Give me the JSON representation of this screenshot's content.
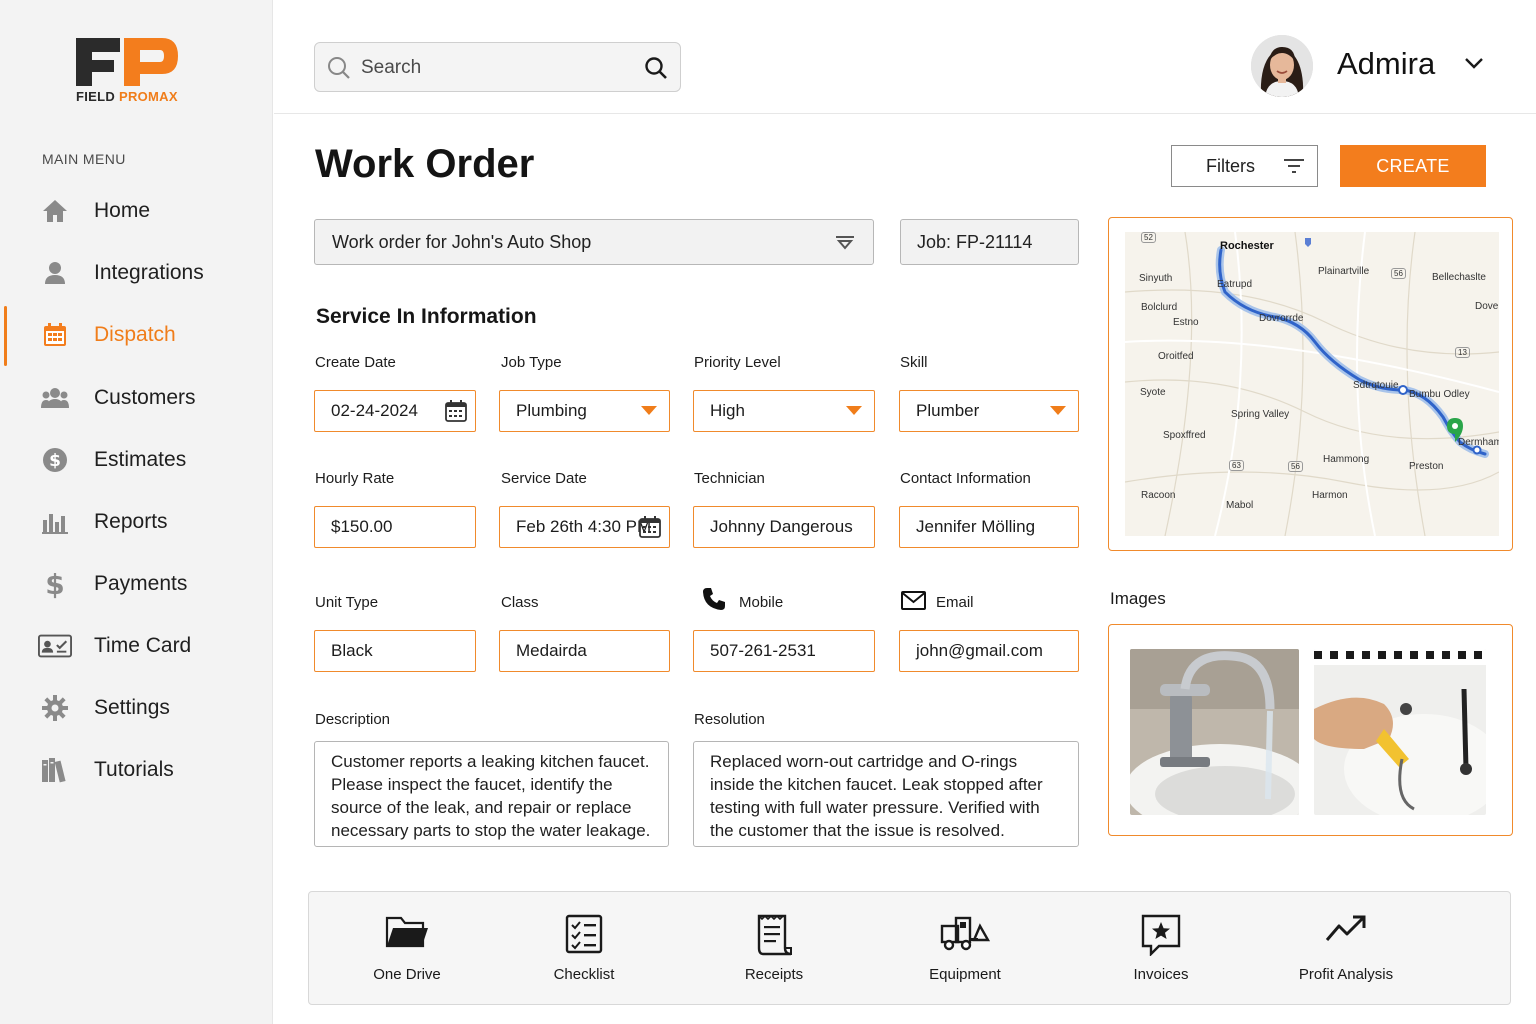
{
  "brand": {
    "logo_mark": "FP",
    "name_part1": "FIELD ",
    "name_part2": "PROMAX",
    "accent_color": "#f37d1d"
  },
  "sidebar": {
    "menu_title": "MAIN MENU",
    "items": [
      {
        "label": "Home",
        "icon": "home-icon",
        "active": false
      },
      {
        "label": "Integrations",
        "icon": "user-icon",
        "active": false
      },
      {
        "label": "Dispatch",
        "icon": "calendar-icon",
        "active": true
      },
      {
        "label": "Customers",
        "icon": "users-icon",
        "active": false
      },
      {
        "label": "Estimates",
        "icon": "dollar-circle-icon",
        "active": false
      },
      {
        "label": "Reports",
        "icon": "bar-chart-icon",
        "active": false
      },
      {
        "label": "Payments",
        "icon": "dollar-icon",
        "active": false
      },
      {
        "label": "Time Card",
        "icon": "id-card-icon",
        "active": false
      },
      {
        "label": "Settings",
        "icon": "gear-icon",
        "active": false
      },
      {
        "label": "Tutorials",
        "icon": "books-icon",
        "active": false
      }
    ]
  },
  "topbar": {
    "search_placeholder": "Search",
    "user_name": "Admira"
  },
  "header": {
    "title": "Work Order",
    "filters_label": "Filters",
    "create_label": "CREATE"
  },
  "work_order": {
    "selected": "Work order for John's Auto Shop",
    "job": "Job: FP-21114"
  },
  "service": {
    "section_title": "Service In Information",
    "create_date_label": "Create Date",
    "create_date": "02-24-2024",
    "job_type_label": "Job Type",
    "job_type": "Plumbing",
    "priority_label": "Priority Level",
    "priority": "High",
    "skill_label": "Skill",
    "skill": "Plumber",
    "hourly_rate_label": "Hourly Rate",
    "hourly_rate": "$150.00",
    "service_date_label": "Service Date",
    "service_date": "Feb 26th 4:30 PM",
    "technician_label": "Technician",
    "technician": "Johnny Dangerous",
    "contact_label": "Contact Information",
    "contact": "Jennifer Mölling",
    "unit_type_label": "Unit Type",
    "unit_type": "Black",
    "class_label": "Class",
    "class": "Medairda",
    "mobile_label": "Mobile",
    "mobile": "507-261-2531",
    "email_label": "Email",
    "email": "john@gmail.com",
    "description_label": "Description",
    "description": "Customer reports a leaking kitchen faucet. Please inspect the faucet, identify the source of the leak, and repair or replace necessary parts to stop the water leakage.",
    "resolution_label": "Resolution",
    "resolution": "Replaced worn-out cartridge and O-rings inside the kitchen faucet. Leak stopped after testing with full water pressure. Verified with the customer that the issue is resolved."
  },
  "map": {
    "labels": {
      "rochester": "Rochester",
      "plainartville": "Plainartville",
      "bellechaslte": "Bellechaslte",
      "dover": "Dover",
      "sinyuth": "Sinyuth",
      "bolclurd": "Bolclurd",
      "eatrupd": "Eatrupd",
      "estno": "Estno",
      "dovrorrde": "Dovrorrde",
      "oroitfed": "Oroitfed",
      "syote": "Syote",
      "sdtrqtouie": "Sdtrqtouie",
      "bumbu_odley": "Bumbu Odley",
      "spring_valley": "Spring Valley",
      "spoxffred": "Spoxffred",
      "hammong": "Hammong",
      "preston": "Preston",
      "racoon": "Racoon",
      "mabol": "Mabol",
      "harmon": "Harmon",
      "dermham": "Dermham",
      "shield_52": "52",
      "shield_56": "56",
      "shield_63": "63",
      "shield_13": "13"
    }
  },
  "images": {
    "label": "Images"
  },
  "toolbar": [
    {
      "label": "One Drive",
      "icon": "folder-icon"
    },
    {
      "label": "Checklist",
      "icon": "checklist-icon"
    },
    {
      "label": "Receipts",
      "icon": "receipt-icon"
    },
    {
      "label": "Equipment",
      "icon": "truck-icon"
    },
    {
      "label": "Invoices",
      "icon": "star-doc-icon"
    },
    {
      "label": "Profit Analysis",
      "icon": "trend-up-icon"
    }
  ]
}
